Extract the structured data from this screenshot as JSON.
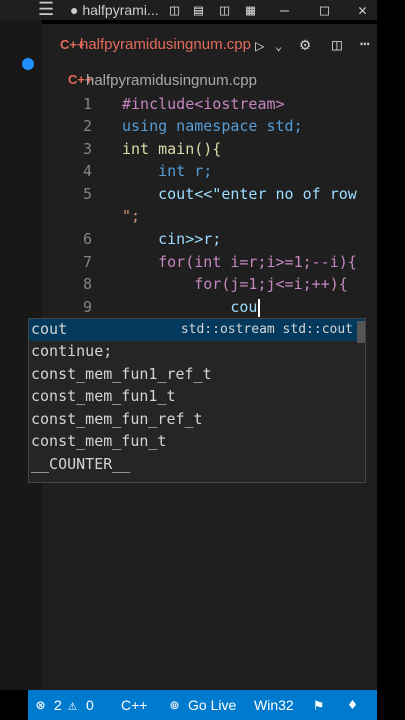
{
  "titlebar": {
    "tab_title": "● halfpyrami..."
  },
  "tab": {
    "file_name": "halfpyramidusingnum.cpp",
    "file_icon": "C++"
  },
  "breadcrumb": {
    "file_name": "halfpyramidusingnum.cpp",
    "file_icon": "C++"
  },
  "editor": {
    "line_numbers": [
      "1",
      "2",
      "3",
      "4",
      "5",
      "6",
      "7",
      "8",
      "9"
    ],
    "lines": [
      "#include<iostream>",
      "using namespace std;",
      "int main(){",
      "    int r;",
      "    cout<<\"enter no of row ",
      "\";",
      "    cin>>r;",
      "    for(int i=r;i>=1;--i){",
      "        for(j=1;j<=i;++){",
      "            cou"
    ]
  },
  "suggestions": {
    "selected_detail": "std::ostream std::cout",
    "items": [
      {
        "label": "cout"
      },
      {
        "label": "continue;"
      },
      {
        "label": "const_mem_fun1_ref_t"
      },
      {
        "label": "const_mem_fun1_t"
      },
      {
        "label": "const_mem_fun_ref_t"
      },
      {
        "label": "const_mem_fun_t"
      },
      {
        "label": "__COUNTER__"
      }
    ]
  },
  "statusbar": {
    "errors": "2",
    "warnings": "0",
    "language": "C++",
    "go_live": "Go Live",
    "platform": "Win32"
  }
}
